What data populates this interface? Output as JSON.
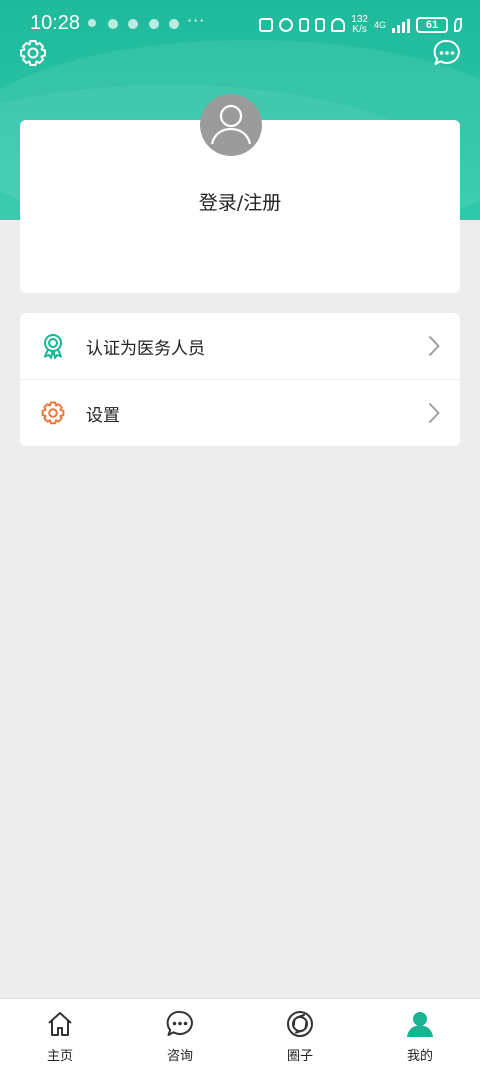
{
  "status_bar": {
    "time": "10:28",
    "more": "···",
    "net_speed_value": "132",
    "net_speed_unit": "K/s",
    "network": "4G",
    "battery": "61"
  },
  "header": {
    "settings_icon": "gear-icon",
    "message_icon": "chat-bubble-icon"
  },
  "profile": {
    "login_label": "登录/注册"
  },
  "menu": {
    "items": [
      {
        "label": "认证为医务人员",
        "icon": "badge-icon",
        "color": "#1ab394"
      },
      {
        "label": "设置",
        "icon": "gear-icon",
        "color": "#e87a3c"
      }
    ]
  },
  "tabbar": {
    "tabs": [
      {
        "label": "主页",
        "icon": "home-icon"
      },
      {
        "label": "咨询",
        "icon": "chat-icon"
      },
      {
        "label": "圈子",
        "icon": "circle-aperture-icon"
      },
      {
        "label": "我的",
        "icon": "person-icon",
        "active": true
      }
    ],
    "active_color": "#1ab394"
  }
}
